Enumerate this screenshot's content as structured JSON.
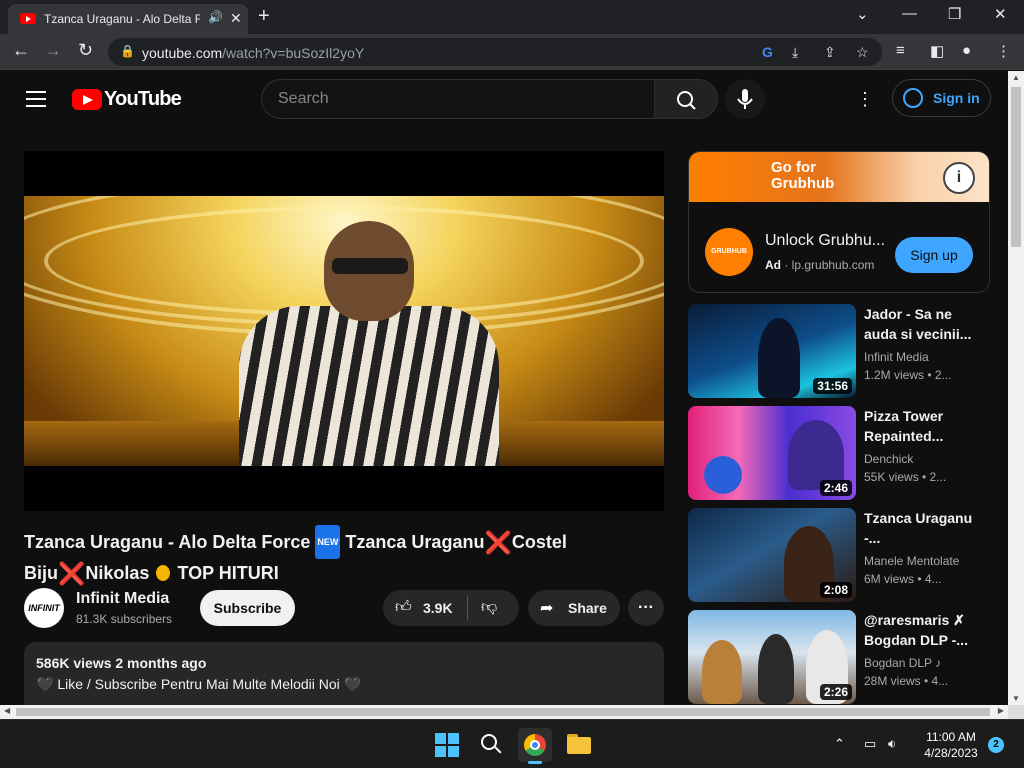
{
  "browser": {
    "tab_title": "Tzanca Uraganu - Alo Delta F",
    "url_host": "youtube.com",
    "url_path": "/watch?v=buSozIl2yoY"
  },
  "youtube": {
    "logo_text": "YouTube",
    "search_placeholder": "Search",
    "signin_label": "Sign in",
    "video": {
      "title_part1": "Tzanca Uraganu - Alo Delta Force ",
      "new_badge": "NEW",
      "title_part2": " Tzanca Uraganu",
      "x_mark": "❌",
      "title_part3": "Costel Biju",
      "title_part4": "Nikolas ",
      "title_part5": " TOP HITURI",
      "channel_name": "Infinit Media",
      "channel_avatar_text": "INFINIT",
      "subscribers": "81.3K subscribers",
      "subscribe_label": "Subscribe",
      "likes": "3.9K",
      "share_label": "Share",
      "views_meta": "586K views  2 months ago",
      "description": "🖤 Like / Subscribe Pentru Mai Multe Melodii Noi 🖤"
    },
    "ad": {
      "banner_text": "Go for Grubhub",
      "logo_text": "GRUBHUB",
      "name": "Unlock Grubhu...",
      "ad_label": "Ad",
      "domain": "lp.grubhub.com",
      "cta": "Sign up"
    },
    "recommendations": [
      {
        "title": "Jador - Sa ne auda si vecinii...",
        "channel": "Infinit Media",
        "views": "1.2M views  • 2...",
        "duration": "31:56"
      },
      {
        "title": "Pizza Tower Repainted...",
        "channel": "Denchick",
        "views": "55K views  • 2...",
        "duration": "2:46"
      },
      {
        "title": "Tzanca Uraganu -...",
        "channel": "Manele Mentolate",
        "views": "6M views  • 4...",
        "duration": "2:08"
      },
      {
        "title": "@raresmaris ✗ Bogdan DLP -...",
        "channel": "Bogdan DLP ♪",
        "views": "28M views  • 4...",
        "duration": "2:26"
      }
    ]
  },
  "taskbar": {
    "time": "11:00 AM",
    "date": "4/28/2023",
    "notifications": "2"
  }
}
